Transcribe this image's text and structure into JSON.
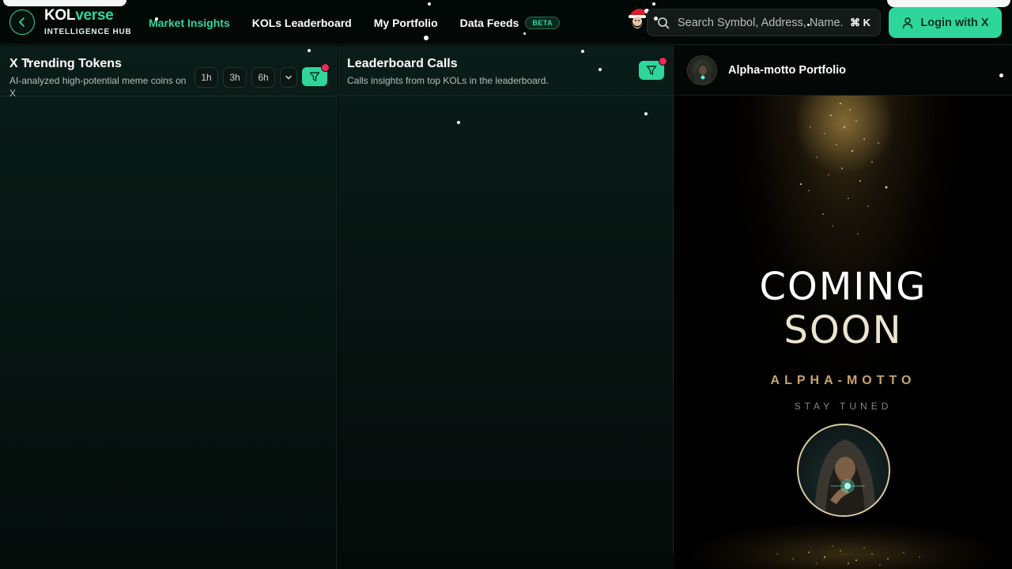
{
  "app": {
    "brand_part1": "KOL",
    "brand_part2": "verse",
    "brand_subtitle": "INTELLIGENCE HUB",
    "accent_color": "#2fd69c"
  },
  "nav": {
    "items": [
      {
        "label": "Market Insights",
        "active": true
      },
      {
        "label": "KOLs Leaderboard",
        "active": false
      },
      {
        "label": "My Portfolio",
        "active": false
      },
      {
        "label": "Data Feeds",
        "badge": "BETA",
        "active": false
      }
    ]
  },
  "search": {
    "placeholder": "Search Symbol, Address, Name...",
    "shortcut": "⌘ K",
    "icon": "search-icon"
  },
  "login": {
    "label": "Login with X",
    "icon": "user-icon"
  },
  "trending": {
    "title": "X Trending Tokens",
    "subtitle": "AI-analyzed high-potential meme coins on X",
    "timeframes": [
      "1h",
      "3h",
      "6h"
    ],
    "filter_icon": "filter-icon",
    "filter_active": true
  },
  "leaderboard_calls": {
    "title": "Leaderboard Calls",
    "subtitle": "Calls insights from top KOLs in the leaderboard.",
    "filter_icon": "filter-icon",
    "filter_active": true
  },
  "portfolio": {
    "title": "Alpha-motto Portfolio",
    "coming_line1": "COMING",
    "coming_line2": "SOON",
    "name": "ALPHA-MOTTO",
    "tagline": "STAY TUNED"
  }
}
